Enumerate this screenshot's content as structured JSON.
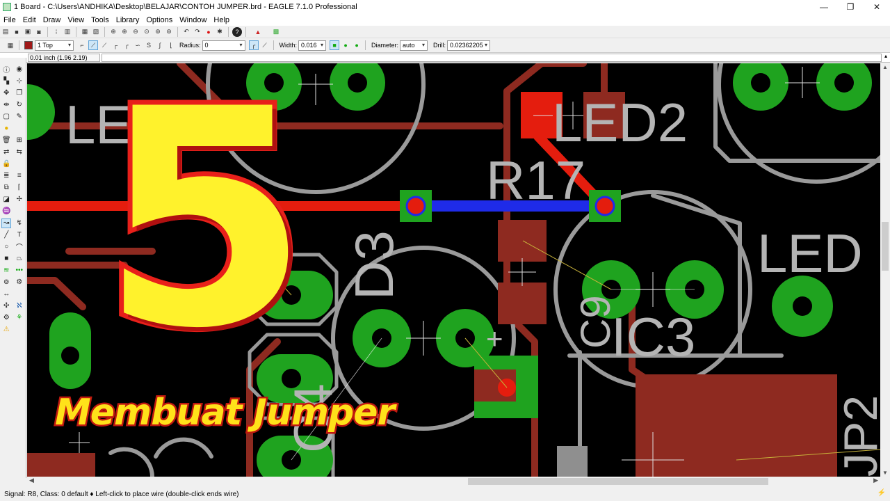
{
  "window": {
    "title": "1 Board - C:\\Users\\ANDHIKA\\Desktop\\BELAJAR\\CONTOH JUMPER.brd - EAGLE 7.1.0 Professional",
    "controls": {
      "minimize": "—",
      "maximize": "❐",
      "close": "✕"
    }
  },
  "menu": [
    "File",
    "Edit",
    "Draw",
    "View",
    "Tools",
    "Library",
    "Options",
    "Window",
    "Help"
  ],
  "toolbar2": {
    "layer": "1 Top",
    "radius_label": "Radius:",
    "radius_value": "0",
    "width_label": "Width:",
    "width_value": "0.016",
    "diameter_label": "Diameter:",
    "diameter_value": "auto",
    "drill_label": "Drill:",
    "drill_value": "0.02362205"
  },
  "coordinate_readout": "0.01 inch (1.96 2.19)",
  "board_labels": {
    "led1": "LED1",
    "led2": "LED2",
    "r17": "R17",
    "led_right": "LED",
    "d3": "D3",
    "c4": "C4",
    "ic3": "IC3",
    "c9": "C9",
    "jp2": "JP2",
    "plus": "+"
  },
  "overlay": {
    "number": "5",
    "caption": "Membuat Jumper"
  },
  "status": {
    "text": "Signal: R8, Class: 0 default  ♦ Left-click to place wire (double-click ends wire)",
    "right_icon": "go-icon"
  },
  "colors": {
    "top_layer": "#e41d0e",
    "bottom_layer": "#1f2be8",
    "pads": "#1fa31f",
    "silkscreen": "#b4b4b4",
    "background": "#000000",
    "overlay_text": "#fff22c",
    "overlay_stroke": "#e8201a"
  }
}
